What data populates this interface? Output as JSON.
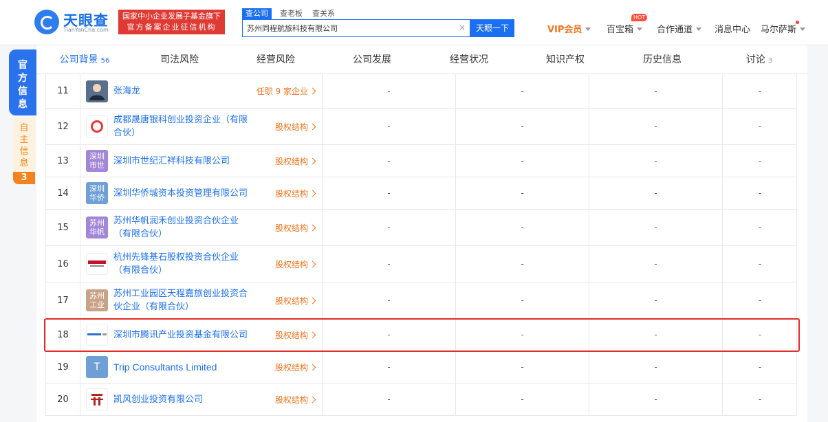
{
  "header": {
    "logo_text": "天眼查",
    "logo_sub": "TianYanCha.com",
    "banner_line1": "国家中小企业发展子基金旗下",
    "banner_line2": "官方备案企业征信机构",
    "search_tabs": [
      "查公司",
      "查老板",
      "查关系"
    ],
    "search_value": "苏州同程航旅科技有限公司",
    "clear_icon": "close-icon",
    "search_button": "天眼一下",
    "nav": {
      "vip": "VIP会员",
      "treasure": "百宝箱",
      "hot_badge": "HOT",
      "cooperation": "合作通道",
      "messages": "消息中心",
      "user": "马尔萨斯"
    }
  },
  "side": {
    "official": "官方信息",
    "self": "自主信息",
    "self_count": "3"
  },
  "tabs": [
    {
      "label": "公司背景",
      "count": "56"
    },
    {
      "label": "司法风险",
      "count": ""
    },
    {
      "label": "经营风险",
      "count": ""
    },
    {
      "label": "公司发展",
      "count": ""
    },
    {
      "label": "经营状况",
      "count": ""
    },
    {
      "label": "知识产权",
      "count": ""
    },
    {
      "label": "历史信息",
      "count": ""
    },
    {
      "label": "讨论",
      "count": "3"
    }
  ],
  "rows": [
    {
      "num": "11",
      "name": "张海龙",
      "avatar_text": "",
      "link": "任职 9 家企业",
      "c1": "-",
      "c2": "-",
      "c3": "-",
      "c4": "-"
    },
    {
      "num": "12",
      "name": "成都晟唐银科创业投资企业（有限合伙）",
      "avatar_text": "",
      "link": "股权结构",
      "c1": "-",
      "c2": "-",
      "c3": "-",
      "c4": "-"
    },
    {
      "num": "13",
      "name": "深圳市世纪汇祥科技有限公司",
      "avatar_text": "深圳市世",
      "link": "股权结构",
      "c1": "-",
      "c2": "-",
      "c3": "-",
      "c4": "-"
    },
    {
      "num": "14",
      "name": "深圳华侨城资本投资管理有限公司",
      "avatar_text": "深圳华侨",
      "link": "股权结构",
      "c1": "-",
      "c2": "-",
      "c3": "-",
      "c4": "-"
    },
    {
      "num": "15",
      "name": "苏州华帆润禾创业投资合伙企业（有限合伙）",
      "avatar_text": "苏州华帆",
      "link": "股权结构",
      "c1": "-",
      "c2": "-",
      "c3": "-",
      "c4": "-"
    },
    {
      "num": "16",
      "name": "杭州先锋基石股权投资合伙企业（有限合伙）",
      "avatar_text": "",
      "link": "股权结构",
      "c1": "-",
      "c2": "-",
      "c3": "-",
      "c4": "-"
    },
    {
      "num": "17",
      "name": "苏州工业园区天程嘉旅创业投资合伙企业（有限合伙）",
      "avatar_text": "苏州工业",
      "link": "股权结构",
      "c1": "-",
      "c2": "-",
      "c3": "-",
      "c4": "-"
    },
    {
      "num": "18",
      "name": "深圳市腾讯产业投资基金有限公司",
      "avatar_text": "",
      "link": "股权结构",
      "c1": "-",
      "c2": "-",
      "c3": "-",
      "c4": "-"
    },
    {
      "num": "19",
      "name": "Trip Consultants Limited",
      "avatar_text": "T",
      "link": "股权结构",
      "c1": "-",
      "c2": "-",
      "c3": "-",
      "c4": "-"
    },
    {
      "num": "20",
      "name": "凯风创业投资有限公司",
      "avatar_text": "",
      "link": "股权结构",
      "c1": "-",
      "c2": "-",
      "c3": "-",
      "c4": "-"
    }
  ],
  "colors": {
    "brand_blue": "#1b6ff3",
    "link_orange": "#f5731a",
    "highlight_red": "#e52a26"
  }
}
